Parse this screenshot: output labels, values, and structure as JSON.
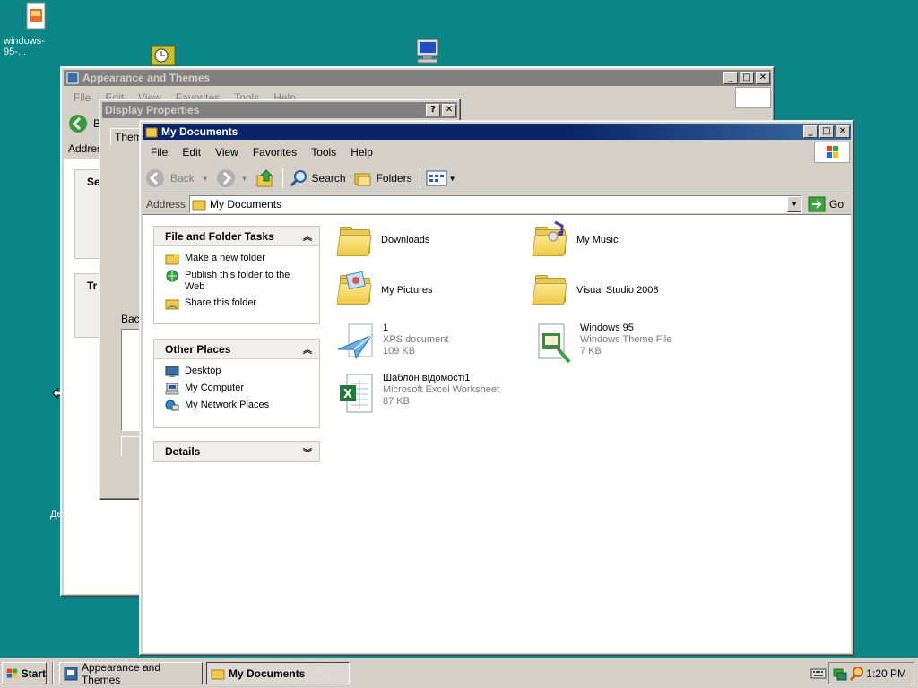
{
  "desktop": {
    "icon1_label": "windows-95-...",
    "side_label": "Де"
  },
  "appearance_window": {
    "title": "Appearance and Themes",
    "menu": [
      "File",
      "Edit",
      "View",
      "Favorites",
      "Tools",
      "Help"
    ],
    "back_label": "B",
    "address_label": "Addres",
    "side_a": "Se",
    "side_b": "Tr"
  },
  "display_window": {
    "title": "Display Properties",
    "tab": "Them",
    "background_label": "Bac"
  },
  "mydocs_window": {
    "title": "My Documents",
    "menu": [
      "File",
      "Edit",
      "View",
      "Favorites",
      "Tools",
      "Help"
    ],
    "toolbar": {
      "back": "Back",
      "search": "Search",
      "folders": "Folders"
    },
    "address": {
      "label": "Address",
      "value": "My Documents",
      "go": "Go"
    },
    "file_tasks": {
      "header": "File and Folder Tasks",
      "items": [
        "Make a new folder",
        "Publish this folder to the Web",
        "Share this folder"
      ]
    },
    "other_places": {
      "header": "Other Places",
      "items": [
        "Desktop",
        "My Computer",
        "My Network Places"
      ]
    },
    "details": {
      "header": "Details"
    },
    "files": [
      {
        "name": "Downloads"
      },
      {
        "name": "My Music"
      },
      {
        "name": "My Pictures"
      },
      {
        "name": "Visual Studio 2008"
      },
      {
        "name": "1",
        "type": "XPS document",
        "size": "109 KB"
      },
      {
        "name": "Windows 95",
        "type": "Windows Theme File",
        "size": "7 KB"
      },
      {
        "name": "Шаблон відомості1",
        "type": "Microsoft Excel Worksheet",
        "size": "87 KB"
      }
    ]
  },
  "taskbar": {
    "start": "Start",
    "tasks": [
      "Appearance and Themes",
      "My Documents"
    ],
    "clock": "1:20 PM"
  }
}
